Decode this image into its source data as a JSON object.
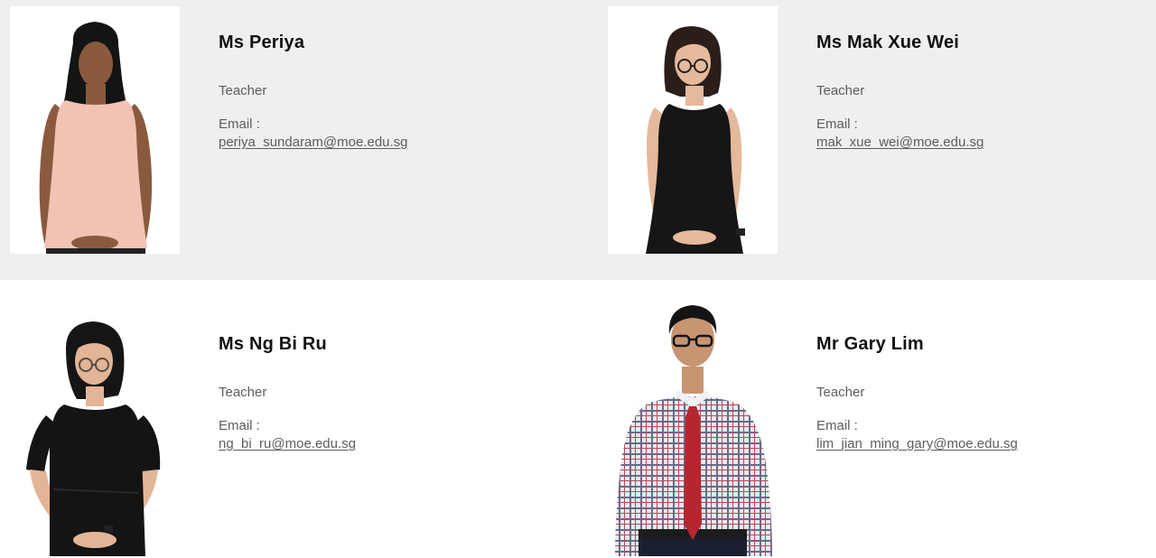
{
  "staff": [
    {
      "name": "Ms Periya",
      "role": "Teacher",
      "email_label": "Email :",
      "email": "periya_sundaram@moe.edu.sg"
    },
    {
      "name": "Ms Mak Xue Wei",
      "role": "Teacher",
      "email_label": "Email :",
      "email": "mak_xue_wei@moe.edu.sg"
    },
    {
      "name": "Ms Ng Bi Ru",
      "role": "Teacher",
      "email_label": "Email :",
      "email": "ng_bi_ru@moe.edu.sg"
    },
    {
      "name": "Mr Gary Lim",
      "role": "Teacher",
      "email_label": "Email :",
      "email": "lim_jian_ming_gary@moe.edu.sg"
    }
  ],
  "colors": {
    "top_band_background": "#efefef",
    "bottom_band_background": "#ffffff",
    "name_text": "#111111",
    "body_text": "#5d5d5d"
  }
}
